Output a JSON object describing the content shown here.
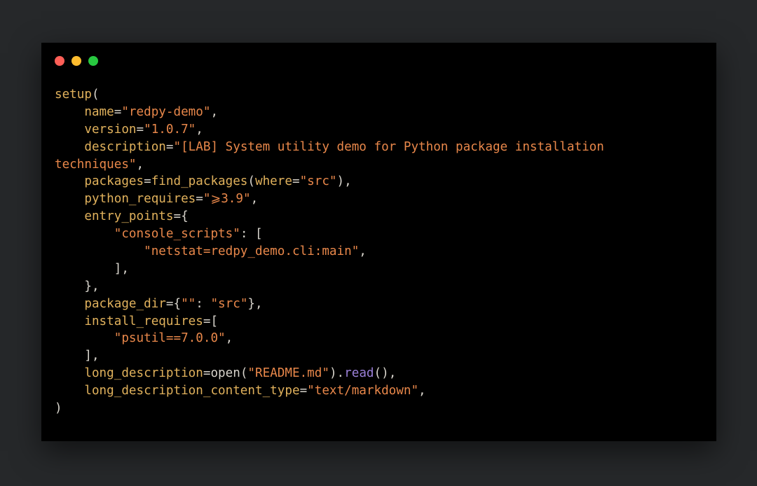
{
  "window": {
    "traffic_lights": [
      {
        "name": "close",
        "color": "#ff5f57"
      },
      {
        "name": "minimize",
        "color": "#febc2e"
      },
      {
        "name": "zoom",
        "color": "#28c840"
      }
    ]
  },
  "colors": {
    "background": "#26282a",
    "editor_background": "#000000",
    "identifier": "#e0b15c",
    "string": "#e8874a",
    "punctuation": "#d8d4cc",
    "method": "#9b80d8"
  },
  "code": {
    "lines": [
      [
        {
          "t": "setup",
          "k": "func"
        },
        {
          "t": "(",
          "k": "punc"
        }
      ],
      [
        {
          "t": "    name",
          "k": "key"
        },
        {
          "t": "=",
          "k": "punc"
        },
        {
          "t": "\"redpy-demo\"",
          "k": "str"
        },
        {
          "t": ",",
          "k": "punc"
        }
      ],
      [
        {
          "t": "    version",
          "k": "key"
        },
        {
          "t": "=",
          "k": "punc"
        },
        {
          "t": "\"1.0.7\"",
          "k": "str"
        },
        {
          "t": ",",
          "k": "punc"
        }
      ],
      [
        {
          "t": "    description",
          "k": "key"
        },
        {
          "t": "=",
          "k": "punc"
        },
        {
          "t": "\"[LAB] System utility demo for Python package installation",
          "k": "str"
        }
      ],
      [
        {
          "t": "techniques\"",
          "k": "str"
        },
        {
          "t": ",",
          "k": "punc"
        }
      ],
      [
        {
          "t": "    packages",
          "k": "key"
        },
        {
          "t": "=",
          "k": "punc"
        },
        {
          "t": "find_packages",
          "k": "func"
        },
        {
          "t": "(",
          "k": "punc"
        },
        {
          "t": "where",
          "k": "key"
        },
        {
          "t": "=",
          "k": "punc"
        },
        {
          "t": "\"src\"",
          "k": "str"
        },
        {
          "t": "),",
          "k": "punc"
        }
      ],
      [
        {
          "t": "    python_requires",
          "k": "key"
        },
        {
          "t": "=",
          "k": "punc"
        },
        {
          "t": "\"⩾3.9\"",
          "k": "str"
        },
        {
          "t": ",",
          "k": "punc"
        }
      ],
      [
        {
          "t": "    entry_points",
          "k": "key"
        },
        {
          "t": "={",
          "k": "punc"
        }
      ],
      [
        {
          "t": "        ",
          "k": "plain"
        },
        {
          "t": "\"console_scripts\"",
          "k": "str"
        },
        {
          "t": ": [",
          "k": "punc"
        }
      ],
      [
        {
          "t": "            ",
          "k": "plain"
        },
        {
          "t": "\"netstat=redpy_demo.cli:main\"",
          "k": "str"
        },
        {
          "t": ",",
          "k": "punc"
        }
      ],
      [
        {
          "t": "        ],",
          "k": "punc"
        }
      ],
      [
        {
          "t": "    },",
          "k": "punc"
        }
      ],
      [
        {
          "t": "    package_dir",
          "k": "key"
        },
        {
          "t": "={",
          "k": "punc"
        },
        {
          "t": "\"\"",
          "k": "str"
        },
        {
          "t": ": ",
          "k": "punc"
        },
        {
          "t": "\"src\"",
          "k": "str"
        },
        {
          "t": "},",
          "k": "punc"
        }
      ],
      [
        {
          "t": "    install_requires",
          "k": "key"
        },
        {
          "t": "=[",
          "k": "punc"
        }
      ],
      [
        {
          "t": "        ",
          "k": "plain"
        },
        {
          "t": "\"psutil==7.0.0\"",
          "k": "str"
        },
        {
          "t": ",",
          "k": "punc"
        }
      ],
      [
        {
          "t": "    ],",
          "k": "punc"
        }
      ],
      [
        {
          "t": "    long_description",
          "k": "key"
        },
        {
          "t": "=",
          "k": "punc"
        },
        {
          "t": "open",
          "k": "plain"
        },
        {
          "t": "(",
          "k": "punc"
        },
        {
          "t": "\"README.md\"",
          "k": "str"
        },
        {
          "t": ").",
          "k": "punc"
        },
        {
          "t": "read",
          "k": "method"
        },
        {
          "t": "(),",
          "k": "punc"
        }
      ],
      [
        {
          "t": "    long_description_content_type",
          "k": "key"
        },
        {
          "t": "=",
          "k": "punc"
        },
        {
          "t": "\"text/markdown\"",
          "k": "str"
        },
        {
          "t": ",",
          "k": "punc"
        }
      ],
      [
        {
          "t": ")",
          "k": "punc"
        }
      ]
    ]
  }
}
